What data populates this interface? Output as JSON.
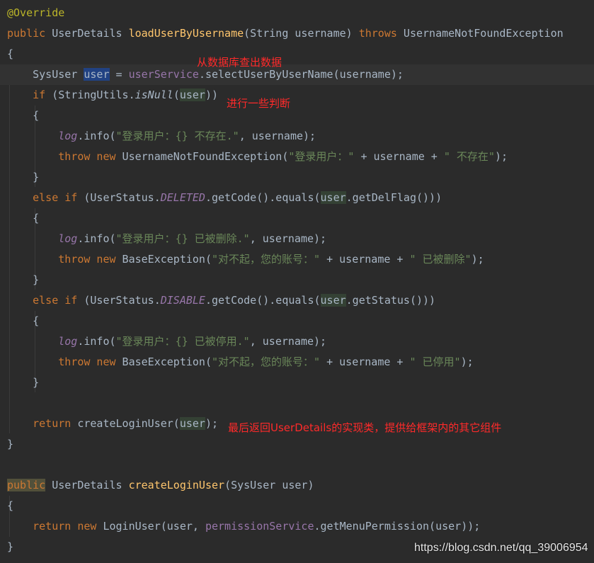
{
  "editor": {
    "colors": {
      "background": "#2b2b2b",
      "keyword": "#cc7832",
      "method": "#ffc66d",
      "string": "#6a8759",
      "field": "#9876aa",
      "annotation": "#bbb529",
      "note": "#ff2a2a"
    },
    "lines": [
      [
        [
          "@Override",
          "ann"
        ]
      ],
      [
        [
          "public",
          "kw"
        ],
        [
          " UserDetails ",
          "cls"
        ],
        [
          "loadUserByUsername",
          "fn"
        ],
        [
          "(String username) ",
          "cls"
        ],
        [
          "throws",
          "kw"
        ],
        [
          " UsernameNotFoundException",
          "cls"
        ]
      ],
      [
        [
          "{",
          "cls"
        ]
      ],
      [
        [
          "    SysUser ",
          "cls"
        ],
        [
          "user",
          "hl-write"
        ],
        [
          " = ",
          "cls"
        ],
        [
          "userService",
          "field"
        ],
        [
          ".selectUserByUserName(username);",
          "cls"
        ]
      ],
      [
        [
          "    ",
          "cls"
        ],
        [
          "if",
          "kw"
        ],
        [
          " (StringUtils.",
          "cls"
        ],
        [
          "isNull",
          "smethod"
        ],
        [
          "(",
          "cls"
        ],
        [
          "user",
          "hl-read"
        ],
        [
          "))",
          "cls"
        ]
      ],
      [
        [
          "    {",
          "cls"
        ]
      ],
      [
        [
          "        ",
          "cls"
        ],
        [
          "log",
          "sfield"
        ],
        [
          ".info(",
          "cls"
        ],
        [
          "\"登录用户：{} 不存在.\"",
          "str"
        ],
        [
          ", username);",
          "cls"
        ]
      ],
      [
        [
          "        ",
          "cls"
        ],
        [
          "throw new",
          "kw"
        ],
        [
          " UsernameNotFoundException(",
          "cls"
        ],
        [
          "\"登录用户：\"",
          "str"
        ],
        [
          " + username + ",
          "cls"
        ],
        [
          "\" 不存在\"",
          "str"
        ],
        [
          ");",
          "cls"
        ]
      ],
      [
        [
          "    }",
          "cls"
        ]
      ],
      [
        [
          "    ",
          "cls"
        ],
        [
          "else if",
          "kw"
        ],
        [
          " (UserStatus.",
          "cls"
        ],
        [
          "DELETED",
          "sfield"
        ],
        [
          ".getCode().equals(",
          "cls"
        ],
        [
          "user",
          "hl-read"
        ],
        [
          ".getDelFlag()))",
          "cls"
        ]
      ],
      [
        [
          "    {",
          "cls"
        ]
      ],
      [
        [
          "        ",
          "cls"
        ],
        [
          "log",
          "sfield"
        ],
        [
          ".info(",
          "cls"
        ],
        [
          "\"登录用户：{} 已被删除.\"",
          "str"
        ],
        [
          ", username);",
          "cls"
        ]
      ],
      [
        [
          "        ",
          "cls"
        ],
        [
          "throw new",
          "kw"
        ],
        [
          " BaseException(",
          "cls"
        ],
        [
          "\"对不起，您的账号：\"",
          "str"
        ],
        [
          " + username + ",
          "cls"
        ],
        [
          "\" 已被删除\"",
          "str"
        ],
        [
          ");",
          "cls"
        ]
      ],
      [
        [
          "    }",
          "cls"
        ]
      ],
      [
        [
          "    ",
          "cls"
        ],
        [
          "else if",
          "kw"
        ],
        [
          " (UserStatus.",
          "cls"
        ],
        [
          "DISABLE",
          "sfield"
        ],
        [
          ".getCode().equals(",
          "cls"
        ],
        [
          "user",
          "hl-read"
        ],
        [
          ".getStatus()))",
          "cls"
        ]
      ],
      [
        [
          "    {",
          "cls"
        ]
      ],
      [
        [
          "        ",
          "cls"
        ],
        [
          "log",
          "sfield"
        ],
        [
          ".info(",
          "cls"
        ],
        [
          "\"登录用户：{} 已被停用.\"",
          "str"
        ],
        [
          ", username);",
          "cls"
        ]
      ],
      [
        [
          "        ",
          "cls"
        ],
        [
          "throw new",
          "kw"
        ],
        [
          " BaseException(",
          "cls"
        ],
        [
          "\"对不起，您的账号：\"",
          "str"
        ],
        [
          " + username + ",
          "cls"
        ],
        [
          "\" 已停用\"",
          "str"
        ],
        [
          ");",
          "cls"
        ]
      ],
      [
        [
          "    }",
          "cls"
        ]
      ],
      [],
      [
        [
          "    ",
          "cls"
        ],
        [
          "return",
          "kw"
        ],
        [
          " createLoginUser(",
          "cls"
        ],
        [
          "user",
          "hl-read"
        ],
        [
          ");",
          "cls"
        ]
      ],
      [
        [
          "}",
          "cls"
        ]
      ],
      [],
      [
        [
          "public",
          "hl-kw kw"
        ],
        [
          " UserDetails ",
          "cls"
        ],
        [
          "createLoginUser",
          "fn"
        ],
        [
          "(SysUser user)",
          "cls"
        ]
      ],
      [
        [
          "{",
          "cls"
        ]
      ],
      [
        [
          "    ",
          "cls"
        ],
        [
          "return new",
          "kw"
        ],
        [
          " LoginUser(user, ",
          "cls"
        ],
        [
          "permissionService",
          "field"
        ],
        [
          ".getMenuPermission(user));",
          "cls"
        ]
      ],
      [
        [
          "}",
          "cls"
        ]
      ]
    ],
    "current_line": 3
  },
  "notes": {
    "query": "从数据库查出数据",
    "check": "进行一些判断",
    "return": "最后返回UserDetails的实现类，提供给框架内的其它组件"
  },
  "watermark": "https://blog.csdn.net/qq_39006954"
}
